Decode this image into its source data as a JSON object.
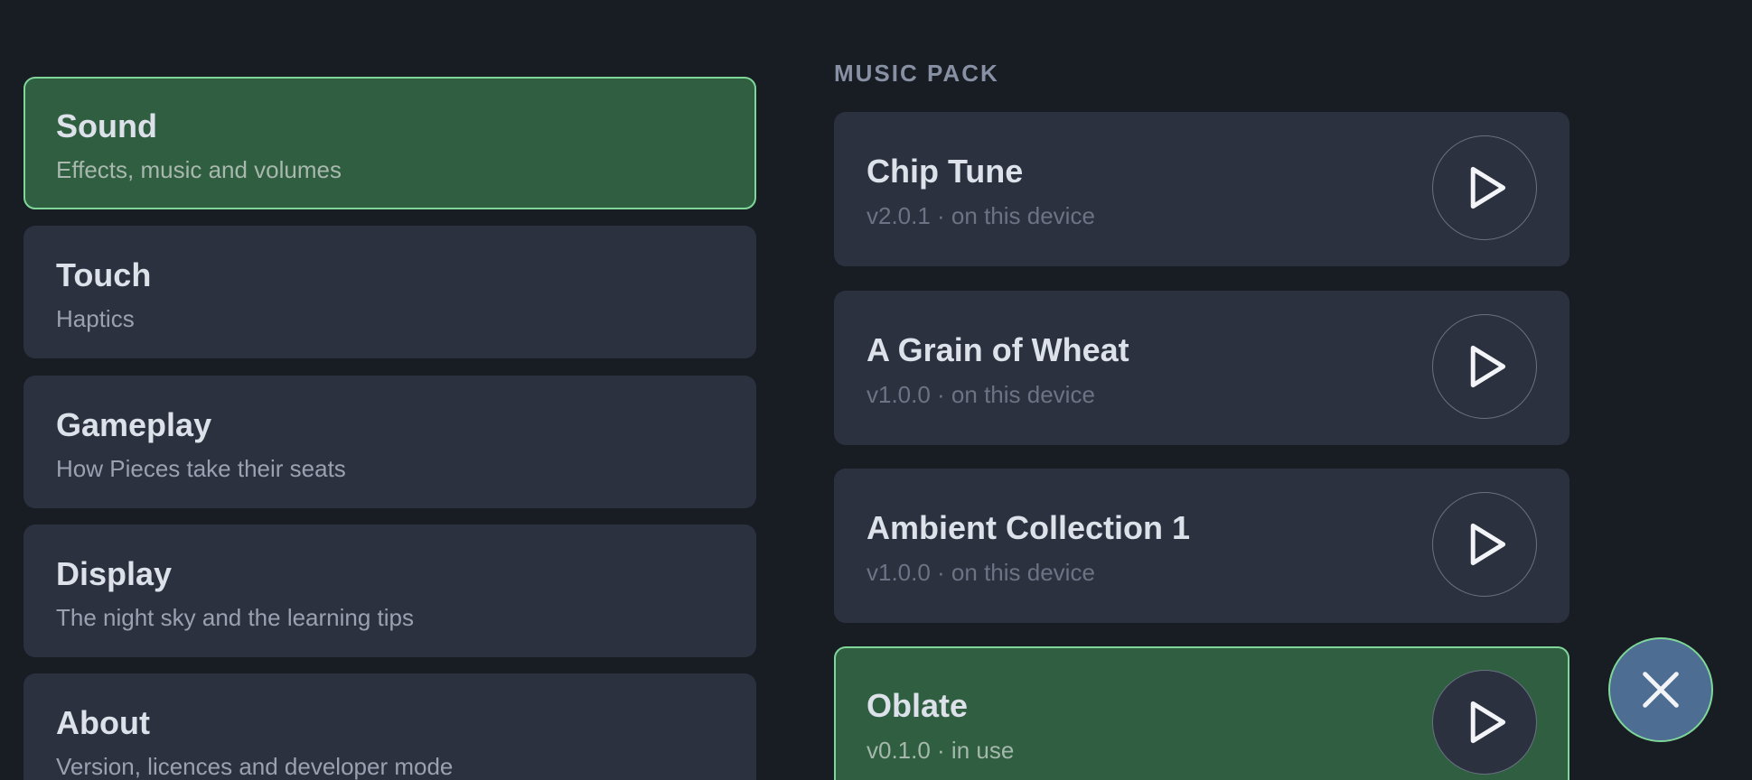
{
  "categories": [
    {
      "title": "Sound",
      "subtitle": "Effects, music and volumes",
      "selected": true
    },
    {
      "title": "Touch",
      "subtitle": "Haptics",
      "selected": false
    },
    {
      "title": "Gameplay",
      "subtitle": "How Pieces take their seats",
      "selected": false
    },
    {
      "title": "Display",
      "subtitle": "The night sky and the learning tips",
      "selected": false
    },
    {
      "title": "About",
      "subtitle": "Version, licences and developer mode",
      "selected": false
    }
  ],
  "music_pack": {
    "heading": "MUSIC PACK",
    "packs": [
      {
        "title": "Chip Tune",
        "subtitle": "v2.0.1 · on this device",
        "selected": false,
        "icon": "play-icon"
      },
      {
        "title": "A Grain of Wheat",
        "subtitle": "v1.0.0 · on this device",
        "selected": false,
        "icon": "play-icon"
      },
      {
        "title": "Ambient Collection 1",
        "subtitle": "v1.0.0 · on this device",
        "selected": false,
        "icon": "play-icon"
      },
      {
        "title": "Oblate",
        "subtitle": "v0.1.0 · in use",
        "selected": true,
        "icon": "play-icon"
      }
    ]
  },
  "close_button": {
    "icon": "close-icon"
  },
  "colors": {
    "background": "#181c23",
    "card": "#2b313e",
    "selected_card": "#2f5e40",
    "selected_border": "#7fd699",
    "close_button": "#4e6d92"
  }
}
